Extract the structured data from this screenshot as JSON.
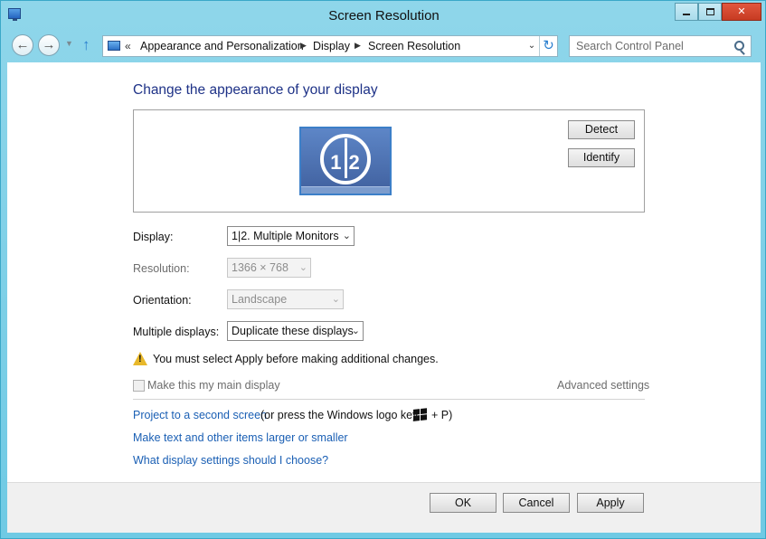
{
  "window": {
    "title": "Screen Resolution",
    "minimize_glyph": "",
    "close_glyph": "✕"
  },
  "address_bar": {
    "overflow": "«",
    "breadcrumbs": [
      "Appearance and Personalization",
      "Display",
      "Screen Resolution"
    ]
  },
  "search": {
    "placeholder": "Search Control Panel"
  },
  "main": {
    "heading": "Change the appearance of your display",
    "monitor_number": "1",
    "monitor_number_2": "2",
    "detect_label": "Detect",
    "identify_label": "Identify",
    "display_label": "Display:",
    "display_value": "1|2. Multiple Monitors",
    "resolution_label": "Resolution:",
    "resolution_value": "1366 × 768",
    "orientation_label": "Orientation:",
    "orientation_value": "Landscape",
    "multiple_label": "Multiple displays:",
    "multiple_value": "Duplicate these displays",
    "warning_text": "You must select Apply before making additional changes.",
    "main_display_label": "Make this my main display",
    "advanced_settings": "Advanced settings",
    "link_project": "Project to a second screen",
    "link_project_note": "(or press the Windows logo key",
    "link_project_note2": "+ P)",
    "link_text_size": "Make text and other items larger or smaller",
    "link_settings": "What display settings should I choose?"
  },
  "footer": {
    "ok": "OK",
    "cancel": "Cancel",
    "apply": "Apply"
  }
}
